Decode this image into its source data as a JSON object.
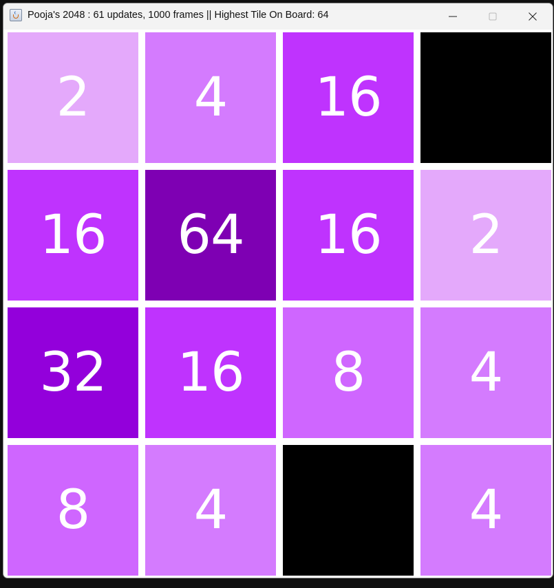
{
  "window": {
    "title": "Pooja's 2048 : 61 updates, 1000 frames || Highest Tile On Board: 64",
    "app_icon": "java-icon",
    "controls": {
      "minimize_icon": "minimize-icon",
      "maximize_icon": "maximize-icon",
      "close_icon": "close-icon"
    }
  },
  "board": {
    "rows": 4,
    "cols": 4,
    "tiles": [
      {
        "value": "2",
        "color": "#e4a9fb"
      },
      {
        "value": "4",
        "color": "#d47bfe"
      },
      {
        "value": "16",
        "color": "#bf33fe"
      },
      {
        "value": "",
        "color": "#000000"
      },
      {
        "value": "16",
        "color": "#bf33fe"
      },
      {
        "value": "64",
        "color": "#7e00b3"
      },
      {
        "value": "16",
        "color": "#bf33fe"
      },
      {
        "value": "2",
        "color": "#e4a9fb"
      },
      {
        "value": "32",
        "color": "#9300db"
      },
      {
        "value": "16",
        "color": "#bf33fe"
      },
      {
        "value": "8",
        "color": "#cf66ff"
      },
      {
        "value": "4",
        "color": "#d47bfe"
      },
      {
        "value": "8",
        "color": "#cf66ff"
      },
      {
        "value": "4",
        "color": "#d47bfe"
      },
      {
        "value": "",
        "color": "#000000"
      },
      {
        "value": "4",
        "color": "#d47bfe"
      }
    ]
  }
}
